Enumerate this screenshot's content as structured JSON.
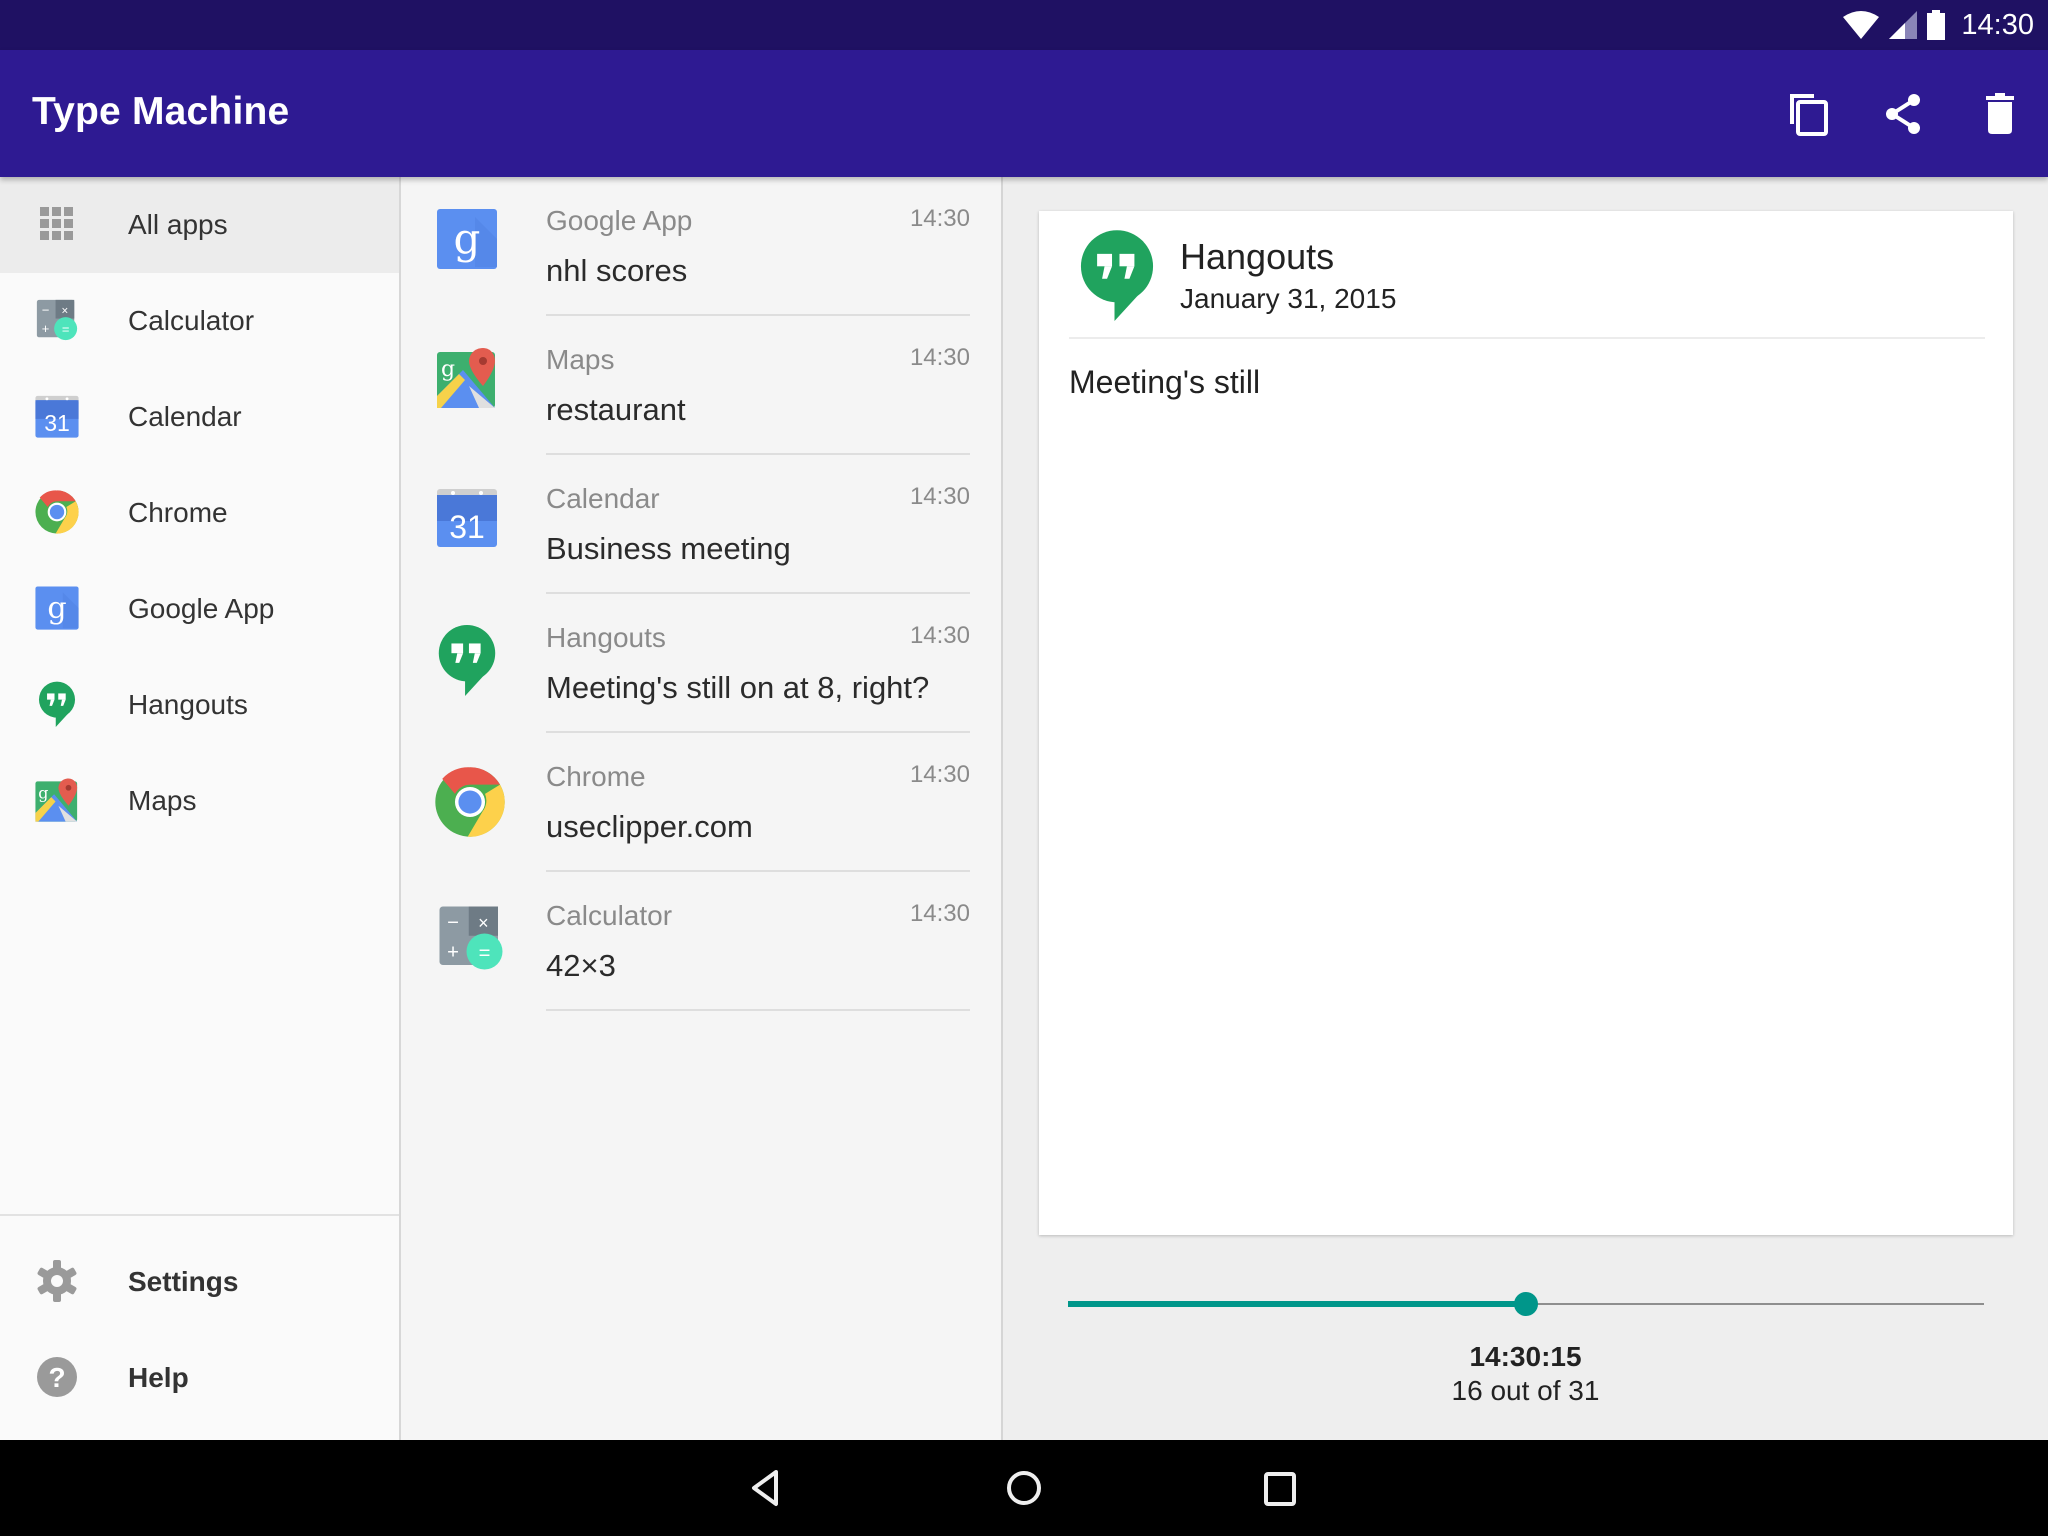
{
  "status_bar": {
    "time": "14:30",
    "icons": [
      "wifi-icon",
      "cell-signal-icon",
      "battery-icon"
    ]
  },
  "app_bar": {
    "title": "Type Machine",
    "actions": [
      {
        "name": "copy",
        "icon": "copy-icon"
      },
      {
        "name": "share",
        "icon": "share-icon"
      },
      {
        "name": "delete",
        "icon": "trash-icon"
      }
    ]
  },
  "sidebar": {
    "items": [
      {
        "label": "All apps",
        "icon": "grid-icon",
        "active": true
      },
      {
        "label": "Calculator",
        "icon": "calculator-icon"
      },
      {
        "label": "Calendar",
        "icon": "calendar-icon"
      },
      {
        "label": "Chrome",
        "icon": "chrome-icon"
      },
      {
        "label": "Google App",
        "icon": "google-icon"
      },
      {
        "label": "Hangouts",
        "icon": "hangouts-icon"
      },
      {
        "label": "Maps",
        "icon": "maps-icon"
      }
    ],
    "footer": [
      {
        "label": "Settings",
        "icon": "gear-icon"
      },
      {
        "label": "Help",
        "icon": "help-icon"
      }
    ]
  },
  "clips": [
    {
      "app": "Google App",
      "time": "14:30",
      "text": "nhl scores",
      "icon": "google-icon"
    },
    {
      "app": "Maps",
      "time": "14:30",
      "text": "restaurant",
      "icon": "maps-icon"
    },
    {
      "app": "Calendar",
      "time": "14:30",
      "text": "Business meeting",
      "icon": "calendar-icon"
    },
    {
      "app": "Hangouts",
      "time": "14:30",
      "text": "Meeting's still on at 8, right?",
      "icon": "hangouts-icon"
    },
    {
      "app": "Chrome",
      "time": "14:30",
      "text": "useclipper.com",
      "icon": "chrome-icon"
    },
    {
      "app": "Calculator",
      "time": "14:30",
      "text": "42×3",
      "icon": "calculator-icon"
    }
  ],
  "detail": {
    "app": "Hangouts",
    "date": "January 31, 2015",
    "body": "Meeting's still",
    "slider": {
      "time": "14:30:15",
      "counter": "16 out of 31",
      "position": 16,
      "total": 31
    },
    "accent": "#00968a"
  },
  "colors": {
    "status_bar": "#1f1163",
    "app_bar": "#2e1a92",
    "accent": "#00968a"
  },
  "nav_bar": {
    "buttons": [
      "back",
      "home",
      "recents"
    ]
  }
}
